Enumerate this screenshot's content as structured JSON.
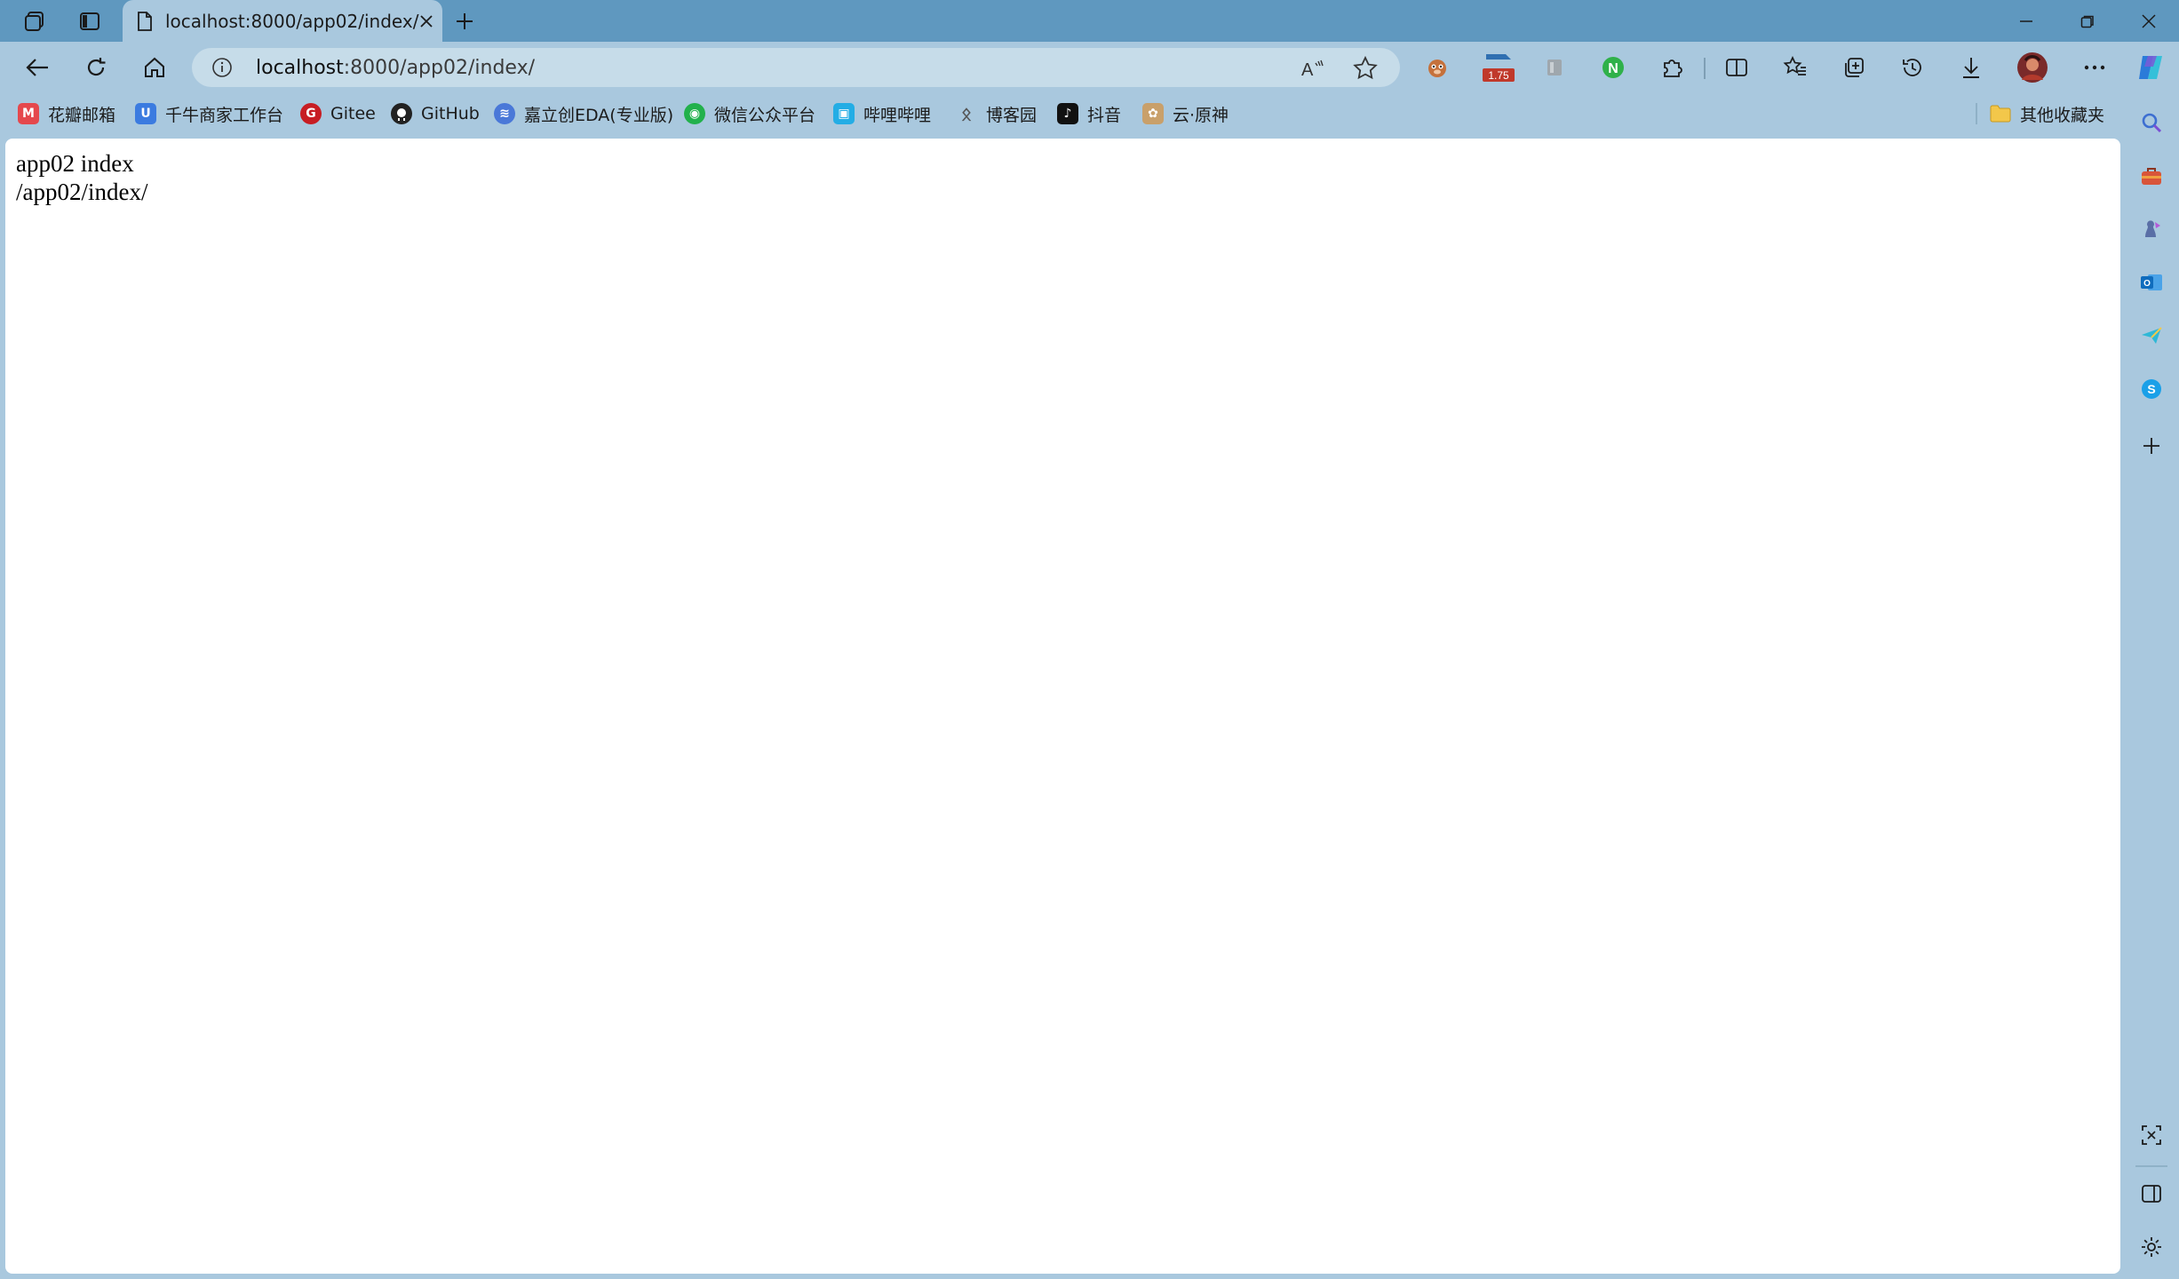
{
  "window": {
    "tab": {
      "title": "localhost:8000/app02/index/"
    }
  },
  "toolbar": {
    "url_host": "localhost",
    "url_path": ":8000/app02/index/",
    "zoom_badge": "1.75"
  },
  "bookmarks": [
    {
      "label": "花瓣邮箱",
      "icon": "mail-icon",
      "color": "#e5484d",
      "glyph": "M"
    },
    {
      "label": "千牛商家工作台",
      "icon": "qianniu-icon",
      "color": "#3b7be0",
      "glyph": "U"
    },
    {
      "label": "Gitee",
      "icon": "gitee-icon",
      "color": "#c71d23",
      "glyph": "G"
    },
    {
      "label": "GitHub",
      "icon": "github-icon",
      "color": "#222222",
      "glyph": "●"
    },
    {
      "label": "嘉立创EDA(专业版)",
      "icon": "easyeda-icon",
      "color": "#4a78d8",
      "glyph": "≋"
    },
    {
      "label": "微信公众平台",
      "icon": "wechat-icon",
      "color": "#22b14c",
      "glyph": "◉"
    },
    {
      "label": "哔哩哔哩",
      "icon": "bilibili-icon",
      "color": "#23ade5",
      "glyph": "▣"
    },
    {
      "label": "博客园",
      "icon": "cnblogs-icon",
      "color": "#555555",
      "glyph": "ᛟ"
    },
    {
      "label": "抖音",
      "icon": "douyin-icon",
      "color": "#111111",
      "glyph": "♪"
    },
    {
      "label": "云·原神",
      "icon": "genshin-icon",
      "color": "#c9a06a",
      "glyph": "✿"
    }
  ],
  "other_favorites": {
    "label": "其他收藏夹",
    "icon": "folder-icon"
  },
  "page": {
    "line1": "app02 index",
    "line2": "/app02/index/"
  },
  "colors": {
    "titlebar": "#5f98bf",
    "chrome": "#a9c8de",
    "address_bar": "#c6dce9"
  }
}
